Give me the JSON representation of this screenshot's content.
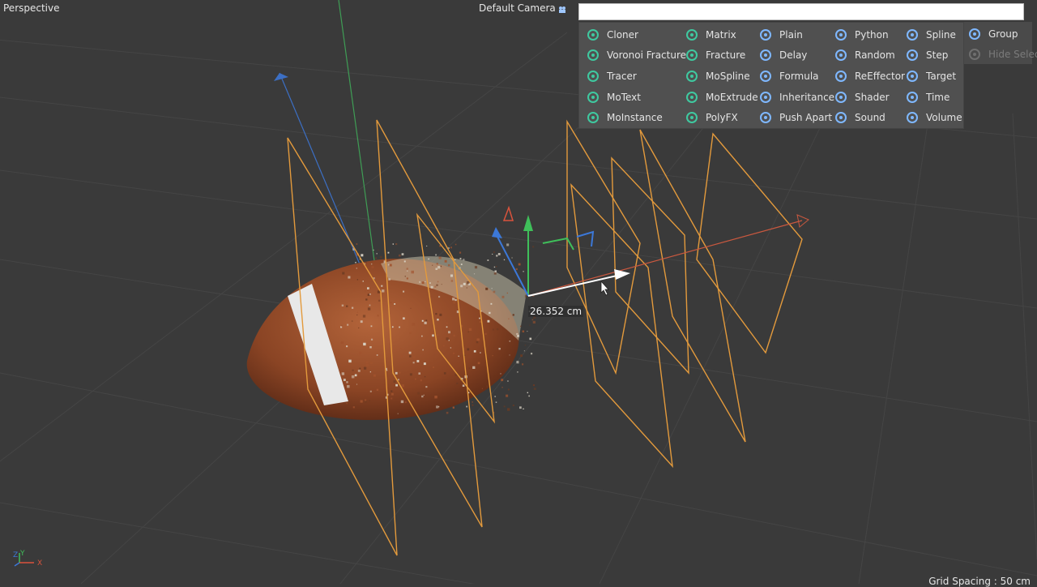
{
  "viewport": {
    "name": "Perspective",
    "camera": "Default Camera",
    "measurement": "26.352 cm",
    "grid_spacing": "Grid Spacing : 50 cm",
    "axis_labels": {
      "y": "Y",
      "z": "Z",
      "x": "X"
    }
  },
  "palette": {
    "search_value": "",
    "columns": [
      [
        {
          "label": "Cloner",
          "icon": "cloner-icon"
        },
        {
          "label": "Voronoi Fracture",
          "icon": "voronoi-fracture-icon"
        },
        {
          "label": "Tracer",
          "icon": "tracer-icon"
        },
        {
          "label": "MoText",
          "icon": "motext-icon"
        },
        {
          "label": "MoInstance",
          "icon": "moinstance-icon"
        }
      ],
      [
        {
          "label": "Matrix",
          "icon": "matrix-icon"
        },
        {
          "label": "Fracture",
          "icon": "fracture-icon"
        },
        {
          "label": "MoSpline",
          "icon": "mospline-icon"
        },
        {
          "label": "MoExtrude",
          "icon": "moextrude-icon"
        },
        {
          "label": "PolyFX",
          "icon": "polyfx-icon"
        }
      ],
      [
        {
          "label": "Plain",
          "icon": "plain-effector-icon"
        },
        {
          "label": "Delay",
          "icon": "delay-effector-icon"
        },
        {
          "label": "Formula",
          "icon": "formula-effector-icon"
        },
        {
          "label": "Inheritance",
          "icon": "inheritance-effector-icon"
        },
        {
          "label": "Push Apart",
          "icon": "push-apart-effector-icon"
        }
      ],
      [
        {
          "label": "Python",
          "icon": "python-effector-icon"
        },
        {
          "label": "Random",
          "icon": "random-effector-icon"
        },
        {
          "label": "ReEffector",
          "icon": "reeffector-icon"
        },
        {
          "label": "Shader",
          "icon": "shader-effector-icon"
        },
        {
          "label": "Sound",
          "icon": "sound-effector-icon"
        }
      ],
      [
        {
          "label": "Spline",
          "icon": "spline-effector-icon"
        },
        {
          "label": "Step",
          "icon": "step-effector-icon"
        },
        {
          "label": "Target",
          "icon": "target-effector-icon"
        },
        {
          "label": "Time",
          "icon": "time-effector-icon"
        },
        {
          "label": "Volume",
          "icon": "volume-effector-icon"
        }
      ]
    ],
    "extra": [
      {
        "label": "Group",
        "icon": "group-effector-icon",
        "enabled": true
      },
      {
        "label": "Hide Selec",
        "icon": "hide-selection-icon",
        "enabled": false
      }
    ]
  },
  "colors": {
    "viewport_bg": "#3a3a3a",
    "grid": "#4a4a4a",
    "selection": "#e39a3c",
    "axis_x": "#d9533c",
    "axis_y": "#3fbf5a",
    "axis_z": "#3c78d8",
    "icon": "#7fb8ff",
    "palette_bg": "#505050"
  }
}
